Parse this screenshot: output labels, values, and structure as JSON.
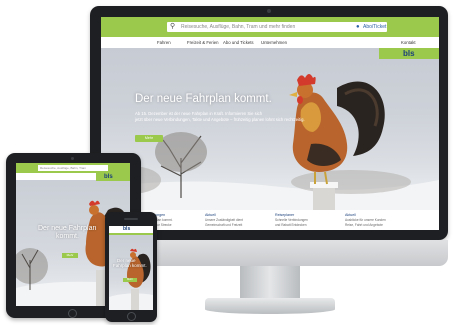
{
  "colors": {
    "brand_green": "#9bc94b",
    "brand_blue": "#1a3f7a",
    "device_black": "#1d1f22",
    "device_silver": "#d4d6d9"
  },
  "desktop": {
    "search": {
      "icon": "search-icon",
      "placeholder": "Reisesuche, Ausflüge, Bahn, Tram und mehr finden",
      "ticket_icon": "ticket-icon",
      "ticket_label": "Abo/Ticket"
    },
    "nav": {
      "items": [
        "Fahren",
        "Freizeit & Ferien",
        "Abo und Tickets",
        "Unternehmen"
      ],
      "login": "Kontakt"
    },
    "logo": "bls",
    "hero": {
      "headline": "Der neue Fahrplan kommt.",
      "subline_1": "Ab 15. Dezember ist der neue Fahrplan in Kraft. Informieren Sie sich",
      "subline_2": "jetzt über neue Verbindungen, Takte und Angebote – frühzeitig planen lohnt sich rechtzeitig.",
      "cta": "Mehr"
    },
    "columns": [
      {
        "heading": "Streckenstörungen",
        "line_1": "Die neue Fahrplan kommt.",
        "line_2": "Informationen zur Strecke"
      },
      {
        "heading": "Aktuell",
        "line_1": "Unsere Zuständigkeit dient",
        "line_2": "Gemeinschaft und Freizeit"
      },
      {
        "heading": "Reiseplaner",
        "line_1": "Schnelle Verbindungen",
        "line_2": "und Rabatt Entdecken"
      },
      {
        "heading": "Aktuell",
        "line_1": "Ausblicke für unsere Kunden",
        "line_2": "Reise, Fahrt und Angebote"
      }
    ]
  },
  "tablet": {
    "search_placeholder": "Reisesuche, Ausflüge, Bahn, Tram",
    "logo": "bls",
    "headline_1": "Der neue Fahrplan",
    "headline_2": "kommt.",
    "cta": "Mehr"
  },
  "phone": {
    "logo": "bls",
    "headline_1": "Der neue",
    "headline_2": "Fahrplan kommt.",
    "cta": "Mehr"
  }
}
